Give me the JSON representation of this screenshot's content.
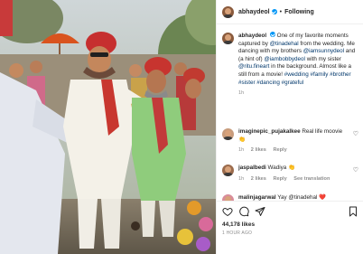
{
  "post": {
    "author": "abhaydeol",
    "follow_status": "Following",
    "separator": "•"
  },
  "caption": {
    "username": "abhaydeol",
    "text_1": "One of my favorite moments captured by ",
    "mention_1": "@tinadehal",
    "text_2": " from the wedding. Me dancing with my brothers ",
    "mention_2": "@iamsunnydeol",
    "text_3": " and (a hint of) ",
    "mention_3": "@iambobbydeol",
    "text_4": " with my sister ",
    "mention_4": "@ritu.fineart",
    "text_5": " in the background. Almost like a still from a movie! ",
    "hashtags": "#wedding #family #brother #sister #dancing #grateful",
    "time": "1h"
  },
  "comments": [
    {
      "username": "imaginepic_pujakalkee",
      "text": "Real life moovie 👏",
      "time": "1h",
      "likes": "2 likes",
      "reply": "Reply",
      "translation": ""
    },
    {
      "username": "jaspalbedi",
      "text": "Wadiya 👏",
      "time": "1h",
      "likes": "2 likes",
      "reply": "Reply",
      "translation": "See translation"
    },
    {
      "username": "malinjagarwal",
      "text": "Yay @tinadehal ❤️"
    }
  ],
  "footer": {
    "like_count": "44,178 likes",
    "post_time": "1 HOUR AGO"
  },
  "icons": {
    "like": "heart-icon",
    "comment": "comment-icon",
    "share": "share-icon",
    "save": "bookmark-icon",
    "comment_like": "heart-icon"
  }
}
